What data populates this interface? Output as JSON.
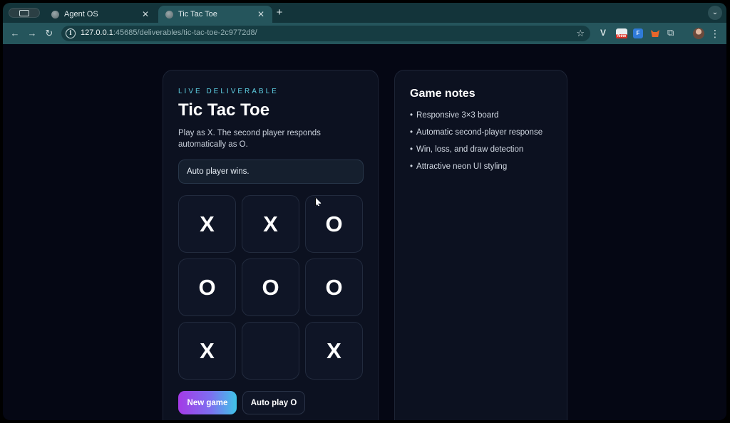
{
  "browser": {
    "tabs": [
      {
        "label": "Agent OS",
        "active": false
      },
      {
        "label": "Tic Tac Toe",
        "active": true
      }
    ],
    "url_host": "127.0.0.1",
    "url_rest": ":45685/deliverables/tic-tac-toe-2c9772d8/",
    "new_badge": "New",
    "ext_f_label": "F"
  },
  "game": {
    "eyebrow": "LIVE DELIVERABLE",
    "title": "Tic Tac Toe",
    "subtitle": "Play as X. The second player responds automatically as O.",
    "status": "Auto player wins.",
    "board": [
      "X",
      "X",
      "O",
      "O",
      "O",
      "O",
      "X",
      "",
      "X"
    ],
    "new_game_label": "New game",
    "auto_play_label": "Auto play O"
  },
  "notes": {
    "title": "Game notes",
    "items": [
      "Responsive 3×3 board",
      "Automatic second-player response",
      "Win, loss, and draw detection",
      "Attractive neon UI styling"
    ]
  },
  "colors": {
    "accent_cyan": "#5fd0e3",
    "button_gradient_start": "#a43ae6",
    "button_gradient_end": "#3fc4e8",
    "card_bg": "#0c1120"
  }
}
